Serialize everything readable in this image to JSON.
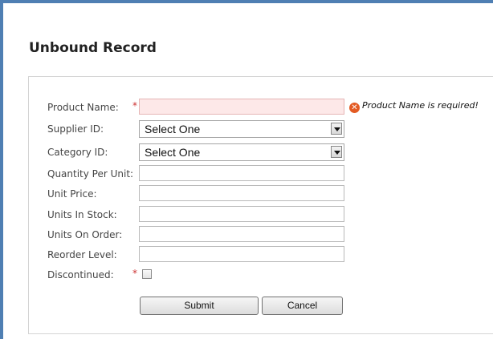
{
  "page": {
    "title": "Unbound Record"
  },
  "form": {
    "product_name": {
      "label": "Product Name:",
      "required_marker": "*",
      "value": "",
      "error": "Product Name is required!"
    },
    "supplier_id": {
      "label": "Supplier ID:",
      "selected": "Select One"
    },
    "category_id": {
      "label": "Category ID:",
      "selected": "Select One"
    },
    "quantity_per_unit": {
      "label": "Quantity Per Unit:",
      "value": ""
    },
    "unit_price": {
      "label": "Unit Price:",
      "value": ""
    },
    "units_in_stock": {
      "label": "Units In Stock:",
      "value": ""
    },
    "units_on_order": {
      "label": "Units On Order:",
      "value": ""
    },
    "reorder_level": {
      "label": "Reorder Level:",
      "value": ""
    },
    "discontinued": {
      "label": "Discontinued:",
      "required_marker": "*",
      "checked": false
    }
  },
  "buttons": {
    "submit": "Submit",
    "cancel": "Cancel"
  },
  "icons": {
    "error": "error-x-icon",
    "dropdown": "chevron-down-icon"
  },
  "colors": {
    "error_icon": "#e35b24",
    "error_field_bg": "#fde8e8",
    "required_star": "#cc3333",
    "window_border": "#4f7fb3"
  }
}
